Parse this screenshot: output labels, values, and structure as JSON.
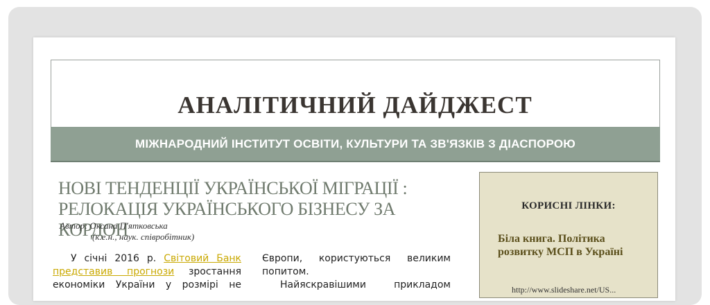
{
  "header": {
    "title": "АНАЛІТИЧНИЙ ДАЙДЖЕСТ",
    "subtitle": "МІЖНАРОДНИЙ ІНСТИТУТ ОСВІТИ, КУЛЬТУРИ ТА ЗВ'ЯЗКІВ З ДІАСПОРОЮ"
  },
  "article": {
    "title_line1": "НОВІ ТЕНДЕНЦІЇ УКРАЇНСЬКОЇ МІГРАЦІЇ :",
    "title_line2": "РЕЛОКАЦІЯ УКРАЇНСЬКОГО БІЗНЕСУ ЗА КОРДОН",
    "author": "Автор: Оксана П'ятковська",
    "author_credentials": "(к.е.н., наук. співробітник)",
    "col1": {
      "line1_prefix": "У січні 2016 р.",
      "line1_link": "Світовий Банк",
      "line2_link": "представив прогнози",
      "line2_suffix": "зростання",
      "line3": "економіки України у розмірі не"
    },
    "col2": {
      "line1": "Європи, користуються великим",
      "line2": "попитом.",
      "line3": "Найяскравішими прикладом"
    }
  },
  "sidebar": {
    "heading": "КОРИСНІ ЛІНКИ:",
    "link_title": "Біла книга. Політика розвитку МСП в Україні",
    "link_url": "http://www.slideshare.net/US..."
  }
}
